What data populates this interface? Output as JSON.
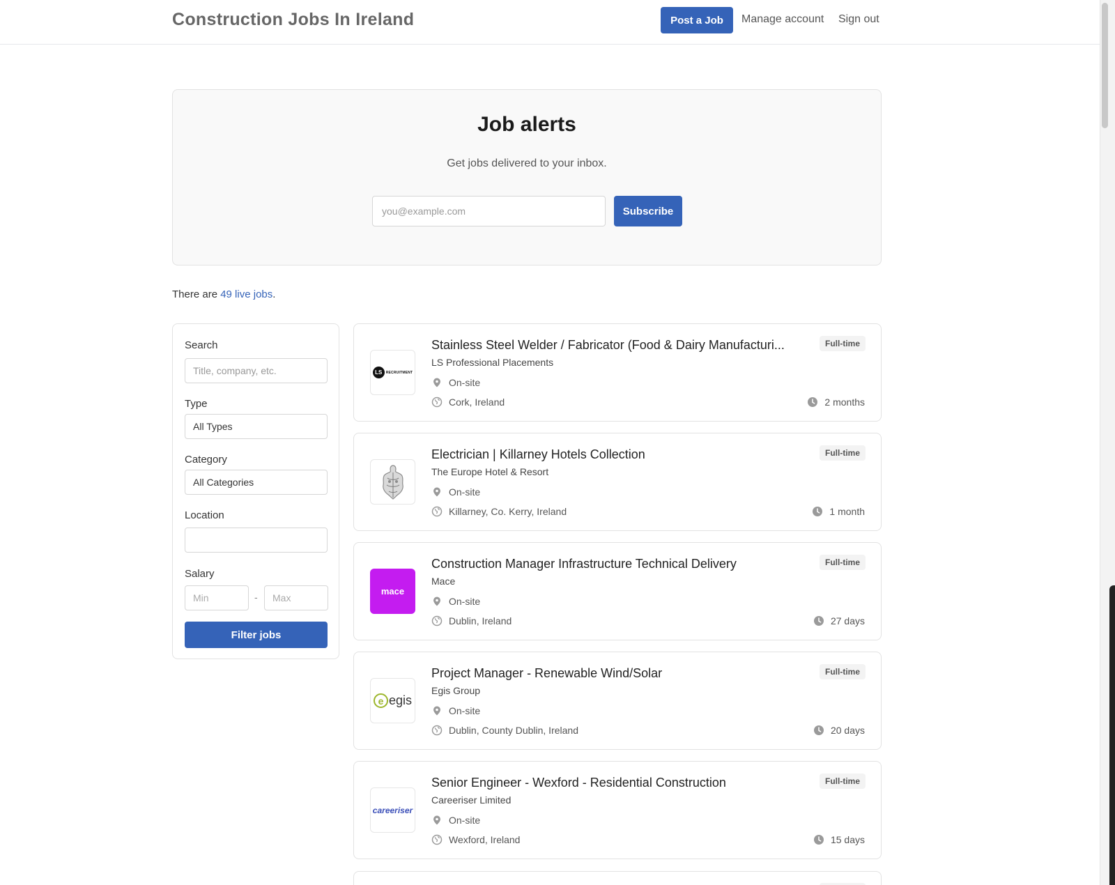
{
  "header": {
    "title": "Construction Jobs In Ireland",
    "post_job": "Post a Job",
    "manage_account": "Manage account",
    "sign_out": "Sign out"
  },
  "alerts": {
    "title": "Job alerts",
    "subtitle": "Get jobs delivered to your inbox.",
    "email_placeholder": "you@example.com",
    "subscribe": "Subscribe"
  },
  "summary": {
    "prefix": "There are ",
    "link": "49 live jobs",
    "suffix": "."
  },
  "filters": {
    "search_label": "Search",
    "search_placeholder": "Title, company, etc.",
    "type_label": "Type",
    "type_value": "All Types",
    "category_label": "Category",
    "category_value": "All Categories",
    "location_label": "Location",
    "location_value": "",
    "salary_label": "Salary",
    "salary_min_placeholder": "Min",
    "salary_separator": "-",
    "salary_max_placeholder": "Max",
    "filter_button": "Filter jobs"
  },
  "jobs": [
    {
      "title": "Stainless Steel Welder / Fabricator (Food & Dairy Manufacturi...",
      "company": "LS Professional Placements",
      "workplace": "On-site",
      "location": "Cork, Ireland",
      "type": "Full-time",
      "age": "2 months",
      "logo_text": "LS",
      "logo_subtext": "RECRUITMENT"
    },
    {
      "title": "Electrician | Killarney Hotels Collection",
      "company": "The Europe Hotel & Resort",
      "workplace": "On-site",
      "location": "Killarney, Co. Kerry, Ireland",
      "type": "Full-time",
      "age": "1 month"
    },
    {
      "title": "Construction Manager Infrastructure Technical Delivery",
      "company": "Mace",
      "workplace": "On-site",
      "location": "Dublin, Ireland",
      "type": "Full-time",
      "age": "27 days",
      "logo_text": "mace"
    },
    {
      "title": "Project Manager - Renewable Wind/Solar",
      "company": "Egis Group",
      "workplace": "On-site",
      "location": "Dublin, County Dublin, Ireland",
      "type": "Full-time",
      "age": "20 days",
      "logo_text": "egis"
    },
    {
      "title": "Senior Engineer - Wexford - Residential Construction",
      "company": "Careeriser Limited",
      "workplace": "On-site",
      "location": "Wexford, Ireland",
      "type": "Full-time",
      "age": "15 days",
      "logo_text": "careeriser"
    }
  ],
  "colors": {
    "accent": "#3563b8",
    "mace_brand": "#c41cf0",
    "egis_brand": "#9cb62b"
  },
  "icons": {
    "workplace": "map-pin-icon",
    "location": "globe-icon",
    "age": "clock-icon"
  }
}
